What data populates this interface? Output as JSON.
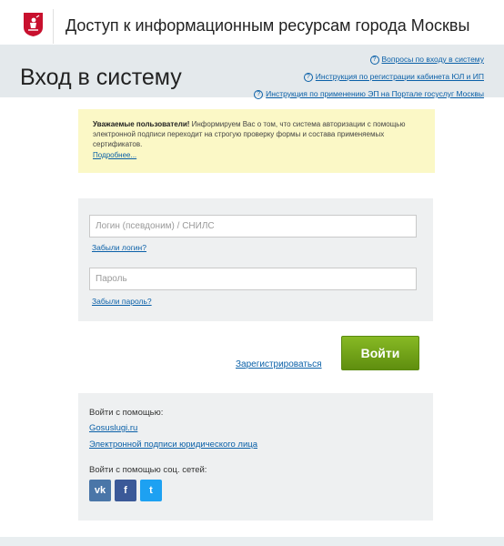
{
  "header": {
    "title": "Доступ к информационным ресурсам города Москвы"
  },
  "hero": {
    "title": "Вход в систему",
    "links": [
      "Вопросы по входу в систему",
      "Инструкция по регистрации кабинета ЮЛ и ИП",
      "Инструкция по применению ЭП на Портале госуслуг Москвы"
    ]
  },
  "notice": {
    "bold": "Уважаемые пользователи!",
    "text": " Информируем Вас о том, что система авторизации с помощью электронной подписи переходит на строгую проверку формы и состава применяемых сертификатов.",
    "more": "Подробнее..."
  },
  "login": {
    "login_placeholder": "Логин (псевдоним) / СНИЛС",
    "forgot_login": "Забыли логин?",
    "password_placeholder": "Пароль",
    "forgot_password": "Забыли пароль?",
    "register": "Зарегистрироваться",
    "submit": "Войти"
  },
  "alternatives": {
    "heading": "Войти с помощью:",
    "gosuslugi": "Gosuslugi.ru",
    "signature": "Электронной подписи юридического лица",
    "social_heading": "Войти с помощью соц. сетей:",
    "social": [
      {
        "icon": "vk-icon",
        "label": "vk",
        "color": "#4a76a8"
      },
      {
        "icon": "facebook-icon",
        "label": "f",
        "color": "#3b5998"
      },
      {
        "icon": "twitter-icon",
        "label": "t",
        "color": "#1da1f2"
      }
    ]
  },
  "colors": {
    "brand_red": "#c8102e",
    "link_blue": "#0a60a8",
    "button_green": "#6fa11a",
    "notice_yellow": "#fbf8c6",
    "panel_gray": "#eef0f1"
  }
}
